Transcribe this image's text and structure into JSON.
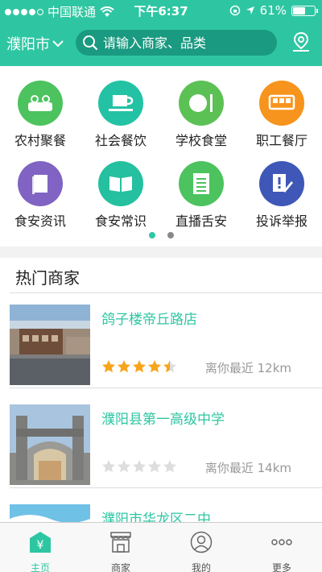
{
  "status_bar": {
    "carrier": "中国联通",
    "time": "下午6:37",
    "battery": "61%",
    "battery_level": 0.61
  },
  "header": {
    "city": "濮阳市",
    "search_placeholder": "请输入商家、品类"
  },
  "categories": [
    {
      "label": "农村聚餐",
      "icon": "group-people-icon",
      "color": "#4cc35e"
    },
    {
      "label": "社会餐饮",
      "icon": "coffee-cup-icon",
      "color": "#23c2a4"
    },
    {
      "label": "学校食堂",
      "icon": "plate-cutlery-icon",
      "color": "#5cc155"
    },
    {
      "label": "职工餐厅",
      "icon": "bus-icon",
      "color": "#f7941d"
    },
    {
      "label": "食安资讯",
      "icon": "book-icon",
      "color": "#8063c2"
    },
    {
      "label": "食安常识",
      "icon": "open-book-icon",
      "color": "#24c0a0"
    },
    {
      "label": "直播舌安",
      "icon": "document-list-icon",
      "color": "#4cc35e"
    },
    {
      "label": "投诉举报",
      "icon": "report-pen-icon",
      "color": "#3f57b7"
    }
  ],
  "pager": {
    "pages": 2,
    "current": 1
  },
  "hot": {
    "title": "热门商家",
    "merchants": [
      {
        "name": "鸽子楼帝丘路店",
        "rating": 4.5,
        "distance": "离你最近 12km"
      },
      {
        "name": "濮阳县第一高级中学",
        "rating": 0,
        "distance": "离你最近 14km"
      },
      {
        "name": "濮阳市华龙区二中",
        "rating": 0,
        "distance": ""
      }
    ]
  },
  "tabbar": [
    {
      "label": "主页",
      "icon": "home-icon",
      "active": true
    },
    {
      "label": "商家",
      "icon": "shop-icon",
      "active": false
    },
    {
      "label": "我的",
      "icon": "user-icon",
      "active": false
    },
    {
      "label": "更多",
      "icon": "more-icon",
      "active": false
    }
  ],
  "colors": {
    "primary": "#2ec6a2",
    "star": "#f7a51c",
    "star_empty": "#dddddd"
  }
}
